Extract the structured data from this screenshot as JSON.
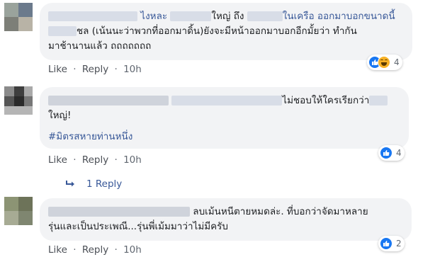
{
  "comments": [
    {
      "author_name": "ไงหละ",
      "text_parts": [
        "ใหญ่ ถึง",
        "ในเครือ ออกมาบอกขนาดนี้",
        "ชล (เน้นนะว่าพวกที่ออกมาดิ้น)ยังจะมีหน้าออกมาบอกอีกมั้ยว่า ทำกัน",
        "มาช้านานแล้ว ถถถถถถถ"
      ],
      "actions": {
        "like": "Like",
        "sep": "·",
        "reply": "Reply",
        "time": "10h"
      },
      "reaction_count": "4"
    },
    {
      "text_parts": [
        "ไม่ชอบให้ใครเรียกว่า",
        "ใหญ่!"
      ],
      "hashtag": "#มิตรสหายท่านหนึ่ง",
      "actions": {
        "like": "Like",
        "sep": "·",
        "reply": "Reply",
        "time": "10h"
      },
      "reaction_count": "4",
      "replies_label": "1 Reply"
    },
    {
      "text_parts": [
        "ลบเม้นหนีตายหมดล่ะ. ที่บอกว่าจัดมาหลาย",
        "รุ่นและเป็นประเพณี...รุ่นพี่เม้มมาว่าไม่มีครับ"
      ],
      "actions": {
        "like": "Like",
        "sep": "·",
        "reply": "Reply",
        "time": "10h"
      },
      "reaction_count": "2"
    }
  ],
  "colors": {
    "link": "#385898",
    "bubble": "#f2f3f5",
    "like_blue": "#1877f2",
    "haha_yellow": "#f7b125"
  },
  "icons": {
    "like": "thumbs-up-icon",
    "haha": "laughing-face-icon",
    "reply_arrow": "reply-arrow-icon"
  }
}
